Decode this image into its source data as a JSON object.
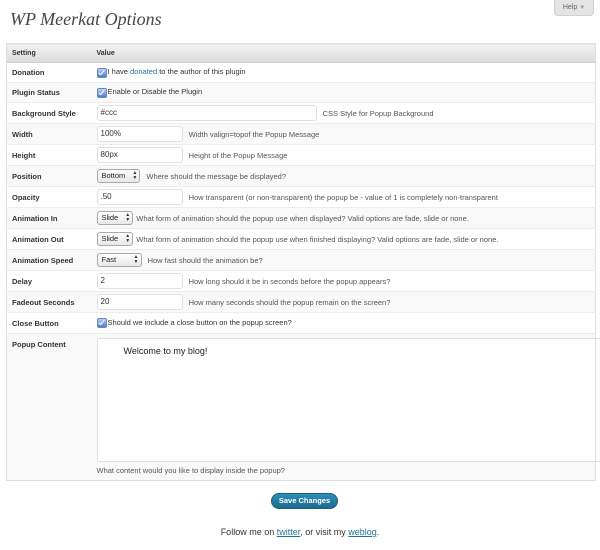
{
  "page": {
    "title": "WP Meerkat Options",
    "help_label": "Help",
    "help_arrow": "▼"
  },
  "table": {
    "headers": {
      "setting": "Setting",
      "value": "Value"
    },
    "donation": {
      "label": "Donation",
      "text_before": "I have ",
      "link": "donated",
      "text_after": " to the author of this plugin",
      "checked": true
    },
    "plugin_status": {
      "label": "Plugin Status",
      "text": "Enable or Disable the Plugin",
      "checked": true
    },
    "background_style": {
      "label": "Background Style",
      "value": "#ccc",
      "hint": "CSS Style for Popup Background"
    },
    "width": {
      "label": "Width",
      "value": "100%",
      "hint": "Width valign=topof the Popup Message"
    },
    "height": {
      "label": "Height",
      "value": "80px",
      "hint": "Height of the Popup Message"
    },
    "position": {
      "label": "Position",
      "selected": "Bottom",
      "hint": "Where should the message be displayed?"
    },
    "opacity": {
      "label": "Opacity",
      "value": ".50",
      "hint": "How transparent (or non-transparent) the popup be - value of 1 is completely non-transparent"
    },
    "animation_in": {
      "label": "Animation In",
      "selected": "Slide",
      "hint": "What form of animation should the popup use when displayed? Valid options are fade, slide or none."
    },
    "animation_out": {
      "label": "Animation Out",
      "selected": "Slide",
      "hint": "What form of animation should the popup use when finished displaying? Valid options are fade, slide or none."
    },
    "animation_speed": {
      "label": "Animation Speed",
      "selected": "Fast",
      "hint": "How fast should the animation be?"
    },
    "delay": {
      "label": "Delay",
      "value": "2",
      "hint": "How long should it be in seconds before the popup appears?"
    },
    "fadeout_seconds": {
      "label": "Fadeout Seconds",
      "value": "20",
      "hint": "How many seconds should the popup remain on the screen?"
    },
    "close_button": {
      "label": "Close Button",
      "text": "Should we include a close button on the popup screen?",
      "checked": true
    },
    "popup_content": {
      "label": "Popup Content",
      "value": "Welcome to my blog!",
      "hint": "What content would you like to display inside the popup?"
    }
  },
  "actions": {
    "save_label": "Save Changes"
  },
  "footer": {
    "text_before": "Follow me on ",
    "twitter": "twitter",
    "text_middle": ", or visit my ",
    "weblog": "weblog",
    "text_after": "."
  },
  "colors": {
    "link": "#21759b",
    "button": "#21759b",
    "header_bg": "#e0e0e0"
  }
}
